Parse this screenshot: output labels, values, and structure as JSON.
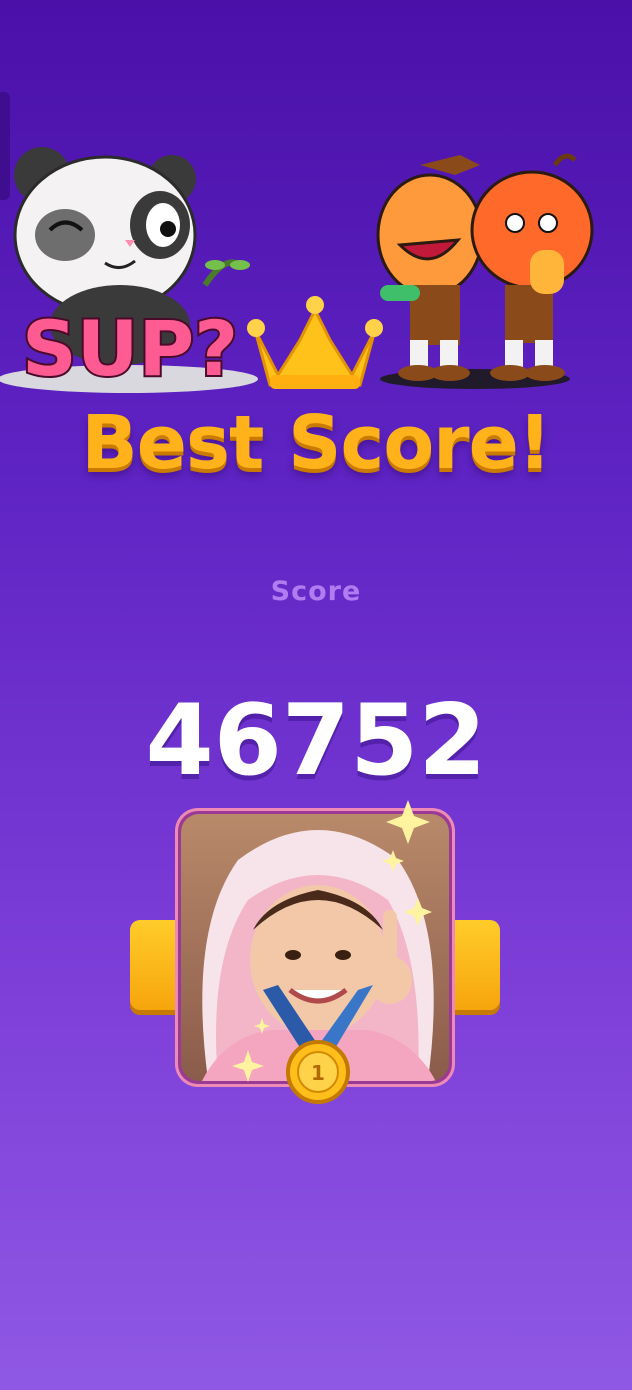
{
  "header": {
    "title": "Best Score!",
    "sticker_text": "SUP?"
  },
  "score": {
    "label": "Score",
    "value": "46752"
  },
  "avatar": {
    "medal_rank": "1"
  },
  "colors": {
    "background_top": "#4a10a8",
    "background_bottom": "#8f58e4",
    "title": "#ffb21a",
    "score_label": "#b07cf0",
    "bar": "#f6a50c"
  },
  "icons": [
    "panda-sticker",
    "crown-icon",
    "pumpkin-characters-sticker",
    "medal-icon",
    "sparkle-icon"
  ]
}
